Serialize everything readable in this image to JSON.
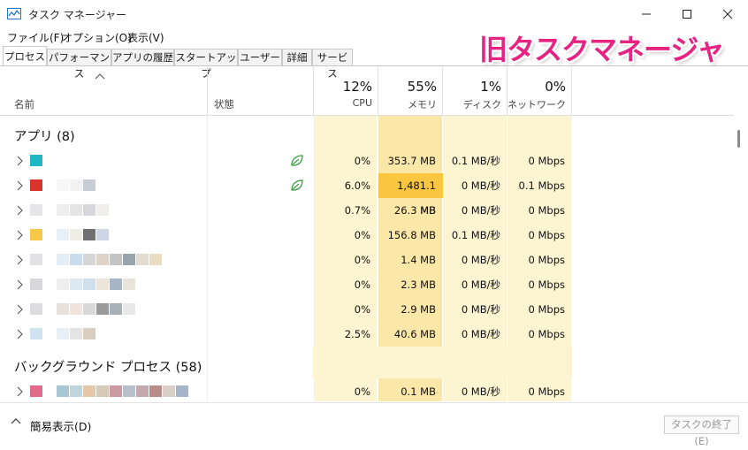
{
  "window": {
    "title": "タスク マネージャー",
    "minimize_icon": "minimize-icon",
    "maximize_icon": "maximize-icon",
    "close_icon": "close-icon"
  },
  "menu": [
    "ファイル(F)",
    "オプション(O)",
    "表示(V)"
  ],
  "tabs": [
    {
      "label": "プロセス",
      "active": true
    },
    {
      "label": "パフォーマンス",
      "active": false
    },
    {
      "label": "アプリの履歴",
      "active": false
    },
    {
      "label": "スタートアップ",
      "active": false
    },
    {
      "label": "ユーザー",
      "active": false
    },
    {
      "label": "詳細",
      "active": false
    },
    {
      "label": "サービス",
      "active": false
    }
  ],
  "banner": "旧タスクマネージャ",
  "header": {
    "name": "名前",
    "status": "状態",
    "cpu": {
      "pct": "12%",
      "label": "CPU"
    },
    "memory": {
      "pct": "55%",
      "label": "メモリ"
    },
    "disk": {
      "pct": "1%",
      "label": "ディスク"
    },
    "network": {
      "pct": "0%",
      "label": "ネットワーク"
    }
  },
  "groups": {
    "apps": "アプリ (8)",
    "background": "バックグラウンド プロセス (58)"
  },
  "rows": [
    {
      "cpu": "0%",
      "mem": "353.7 MB",
      "disk": "0.1 MB/秒",
      "net": "0 Mbps",
      "eco": true,
      "icon_color": "#1fb8c4",
      "mem_highlight": false
    },
    {
      "cpu": "6.0%",
      "mem": "1,481.1 MB",
      "disk": "0 MB/秒",
      "net": "0.1 Mbps",
      "eco": true,
      "icon_color": "#d9342b",
      "mem_highlight": true
    },
    {
      "cpu": "0.7%",
      "mem": "26.3 MB",
      "disk": "0 MB/秒",
      "net": "0 Mbps",
      "eco": false,
      "icon_color": "#e6e6ea",
      "mem_highlight": false
    },
    {
      "cpu": "0%",
      "mem": "156.8 MB",
      "disk": "0.1 MB/秒",
      "net": "0 Mbps",
      "eco": false,
      "icon_color": "#f7c948",
      "mem_highlight": false
    },
    {
      "cpu": "0%",
      "mem": "1.4 MB",
      "disk": "0 MB/秒",
      "net": "0 Mbps",
      "eco": false,
      "icon_color": "#e2e2e6",
      "mem_highlight": false
    },
    {
      "cpu": "0%",
      "mem": "2.3 MB",
      "disk": "0 MB/秒",
      "net": "0 Mbps",
      "eco": false,
      "icon_color": "#d8d8dc",
      "mem_highlight": false
    },
    {
      "cpu": "0%",
      "mem": "2.9 MB",
      "disk": "0 MB/秒",
      "net": "0 Mbps",
      "eco": false,
      "icon_color": "#dcdcdf",
      "mem_highlight": false
    },
    {
      "cpu": "2.5%",
      "mem": "40.6 MB",
      "disk": "0 MB/秒",
      "net": "0 Mbps",
      "eco": false,
      "icon_color": "#cfe3f0",
      "mem_highlight": false
    },
    {
      "cpu": "0%",
      "mem": "0.1 MB",
      "disk": "0 MB/秒",
      "net": "0 Mbps",
      "eco": false,
      "icon_color": "#e06b8b",
      "mem_highlight": false
    }
  ],
  "footer": {
    "fewer_details": "簡易表示(D)",
    "end_task": "タスクの終了(E)"
  },
  "colors": {
    "cell_bg": "#fdf4d2",
    "mem_bg": "#fbe7a8",
    "mem_high_bg": "#f9c640",
    "eco_green": "#3a9d42",
    "banner": "#e62283"
  }
}
